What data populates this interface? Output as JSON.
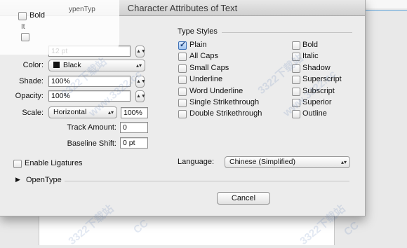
{
  "window": {
    "title": "Character Attributes of Text"
  },
  "overlay": {
    "bold_label": "Bold",
    "partial_text_1": "ypenTyp",
    "partial_text_2": "It"
  },
  "left": {
    "size_value": "12 pt",
    "color_label": "Color:",
    "color_value": "Black",
    "shade_label": "Shade:",
    "shade_value": "100%",
    "opacity_label": "Opacity:",
    "opacity_value": "100%",
    "scale_label": "Scale:",
    "scale_value": "Horizontal",
    "scale_percent": "100%",
    "track_label": "Track Amount:",
    "track_value": "0",
    "baseline_label": "Baseline Shift:",
    "baseline_value": "0 pt",
    "ligatures_label": "Enable Ligatures",
    "opentype_label": "OpenType"
  },
  "type_styles": {
    "heading": "Type Styles",
    "left_column": [
      {
        "label": "Plain",
        "checked": true
      },
      {
        "label": "All Caps",
        "checked": false
      },
      {
        "label": "Small Caps",
        "checked": false
      },
      {
        "label": "Underline",
        "checked": false
      },
      {
        "label": "Word Underline",
        "checked": false
      },
      {
        "label": "Single Strikethrough",
        "checked": false
      },
      {
        "label": "Double Strikethrough",
        "checked": false
      }
    ],
    "right_column": [
      {
        "label": "Bold",
        "checked": false
      },
      {
        "label": "Italic",
        "checked": false
      },
      {
        "label": "Shadow",
        "checked": false
      },
      {
        "label": "Superscript",
        "checked": false
      },
      {
        "label": "Subscript",
        "checked": false
      },
      {
        "label": "Superior",
        "checked": false
      },
      {
        "label": "Outline",
        "checked": false
      }
    ]
  },
  "language": {
    "label": "Language:",
    "value": "Chinese (Simplified)"
  },
  "buttons": {
    "cancel": "Cancel"
  },
  "colors": {
    "accent": "#3b6fb6",
    "dialog_bg": "#ececec"
  }
}
